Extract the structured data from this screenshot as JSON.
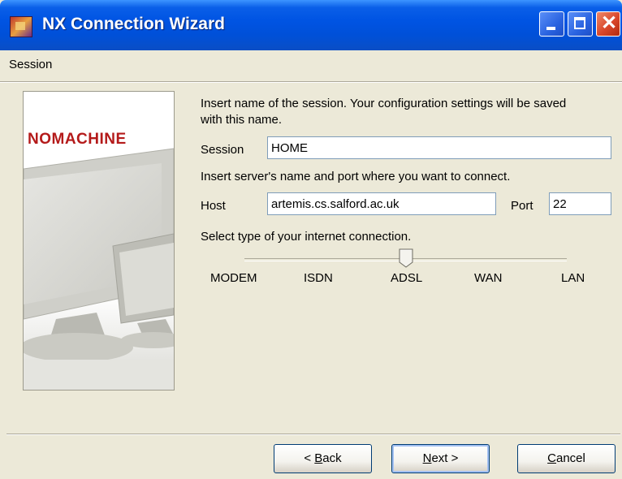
{
  "window": {
    "title": "NX Connection Wizard",
    "buttons": [
      "minimize",
      "maximize",
      "close"
    ]
  },
  "header": {
    "label": "Session"
  },
  "branding": {
    "logo_text": "NOMACHINE",
    "logo_color": "#b41a1a"
  },
  "form": {
    "intro_line1": "Insert name of the session. Your configuration settings will be saved",
    "intro_line2": "with this name.",
    "session_label": "Session",
    "session_value": "HOME",
    "server_instruction": "Insert server's name and port where you want to connect.",
    "host_label": "Host",
    "host_value": "artemis.cs.salford.ac.uk",
    "port_label": "Port",
    "port_value": "22",
    "connection_instruction": "Select type of your internet connection.",
    "connection_types": [
      "MODEM",
      "ISDN",
      "ADSL",
      "WAN",
      "LAN"
    ],
    "connection_selected": "ADSL"
  },
  "buttons": {
    "back_prefix": "< ",
    "back_key": "B",
    "back_rest": "ack",
    "next_key": "N",
    "next_rest": "ext >",
    "cancel_key": "C",
    "cancel_rest": "ancel"
  }
}
